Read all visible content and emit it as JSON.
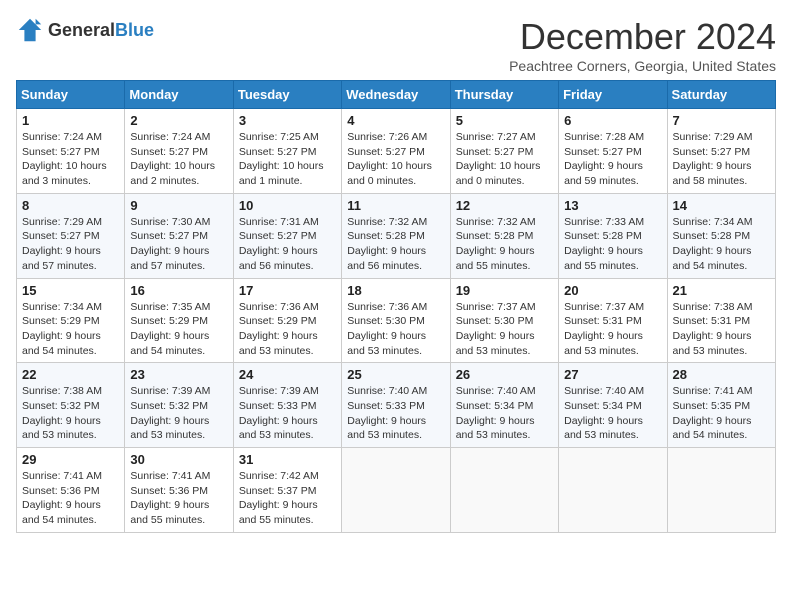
{
  "header": {
    "logo_general": "General",
    "logo_blue": "Blue",
    "month_title": "December 2024",
    "location": "Peachtree Corners, Georgia, United States"
  },
  "weekdays": [
    "Sunday",
    "Monday",
    "Tuesday",
    "Wednesday",
    "Thursday",
    "Friday",
    "Saturday"
  ],
  "weeks": [
    [
      {
        "day": "1",
        "info": "Sunrise: 7:24 AM\nSunset: 5:27 PM\nDaylight: 10 hours\nand 3 minutes."
      },
      {
        "day": "2",
        "info": "Sunrise: 7:24 AM\nSunset: 5:27 PM\nDaylight: 10 hours\nand 2 minutes."
      },
      {
        "day": "3",
        "info": "Sunrise: 7:25 AM\nSunset: 5:27 PM\nDaylight: 10 hours\nand 1 minute."
      },
      {
        "day": "4",
        "info": "Sunrise: 7:26 AM\nSunset: 5:27 PM\nDaylight: 10 hours\nand 0 minutes."
      },
      {
        "day": "5",
        "info": "Sunrise: 7:27 AM\nSunset: 5:27 PM\nDaylight: 10 hours\nand 0 minutes."
      },
      {
        "day": "6",
        "info": "Sunrise: 7:28 AM\nSunset: 5:27 PM\nDaylight: 9 hours\nand 59 minutes."
      },
      {
        "day": "7",
        "info": "Sunrise: 7:29 AM\nSunset: 5:27 PM\nDaylight: 9 hours\nand 58 minutes."
      }
    ],
    [
      {
        "day": "8",
        "info": "Sunrise: 7:29 AM\nSunset: 5:27 PM\nDaylight: 9 hours\nand 57 minutes."
      },
      {
        "day": "9",
        "info": "Sunrise: 7:30 AM\nSunset: 5:27 PM\nDaylight: 9 hours\nand 57 minutes."
      },
      {
        "day": "10",
        "info": "Sunrise: 7:31 AM\nSunset: 5:27 PM\nDaylight: 9 hours\nand 56 minutes."
      },
      {
        "day": "11",
        "info": "Sunrise: 7:32 AM\nSunset: 5:28 PM\nDaylight: 9 hours\nand 56 minutes."
      },
      {
        "day": "12",
        "info": "Sunrise: 7:32 AM\nSunset: 5:28 PM\nDaylight: 9 hours\nand 55 minutes."
      },
      {
        "day": "13",
        "info": "Sunrise: 7:33 AM\nSunset: 5:28 PM\nDaylight: 9 hours\nand 55 minutes."
      },
      {
        "day": "14",
        "info": "Sunrise: 7:34 AM\nSunset: 5:28 PM\nDaylight: 9 hours\nand 54 minutes."
      }
    ],
    [
      {
        "day": "15",
        "info": "Sunrise: 7:34 AM\nSunset: 5:29 PM\nDaylight: 9 hours\nand 54 minutes."
      },
      {
        "day": "16",
        "info": "Sunrise: 7:35 AM\nSunset: 5:29 PM\nDaylight: 9 hours\nand 54 minutes."
      },
      {
        "day": "17",
        "info": "Sunrise: 7:36 AM\nSunset: 5:29 PM\nDaylight: 9 hours\nand 53 minutes."
      },
      {
        "day": "18",
        "info": "Sunrise: 7:36 AM\nSunset: 5:30 PM\nDaylight: 9 hours\nand 53 minutes."
      },
      {
        "day": "19",
        "info": "Sunrise: 7:37 AM\nSunset: 5:30 PM\nDaylight: 9 hours\nand 53 minutes."
      },
      {
        "day": "20",
        "info": "Sunrise: 7:37 AM\nSunset: 5:31 PM\nDaylight: 9 hours\nand 53 minutes."
      },
      {
        "day": "21",
        "info": "Sunrise: 7:38 AM\nSunset: 5:31 PM\nDaylight: 9 hours\nand 53 minutes."
      }
    ],
    [
      {
        "day": "22",
        "info": "Sunrise: 7:38 AM\nSunset: 5:32 PM\nDaylight: 9 hours\nand 53 minutes."
      },
      {
        "day": "23",
        "info": "Sunrise: 7:39 AM\nSunset: 5:32 PM\nDaylight: 9 hours\nand 53 minutes."
      },
      {
        "day": "24",
        "info": "Sunrise: 7:39 AM\nSunset: 5:33 PM\nDaylight: 9 hours\nand 53 minutes."
      },
      {
        "day": "25",
        "info": "Sunrise: 7:40 AM\nSunset: 5:33 PM\nDaylight: 9 hours\nand 53 minutes."
      },
      {
        "day": "26",
        "info": "Sunrise: 7:40 AM\nSunset: 5:34 PM\nDaylight: 9 hours\nand 53 minutes."
      },
      {
        "day": "27",
        "info": "Sunrise: 7:40 AM\nSunset: 5:34 PM\nDaylight: 9 hours\nand 53 minutes."
      },
      {
        "day": "28",
        "info": "Sunrise: 7:41 AM\nSunset: 5:35 PM\nDaylight: 9 hours\nand 54 minutes."
      }
    ],
    [
      {
        "day": "29",
        "info": "Sunrise: 7:41 AM\nSunset: 5:36 PM\nDaylight: 9 hours\nand 54 minutes."
      },
      {
        "day": "30",
        "info": "Sunrise: 7:41 AM\nSunset: 5:36 PM\nDaylight: 9 hours\nand 55 minutes."
      },
      {
        "day": "31",
        "info": "Sunrise: 7:42 AM\nSunset: 5:37 PM\nDaylight: 9 hours\nand 55 minutes."
      },
      null,
      null,
      null,
      null
    ]
  ]
}
